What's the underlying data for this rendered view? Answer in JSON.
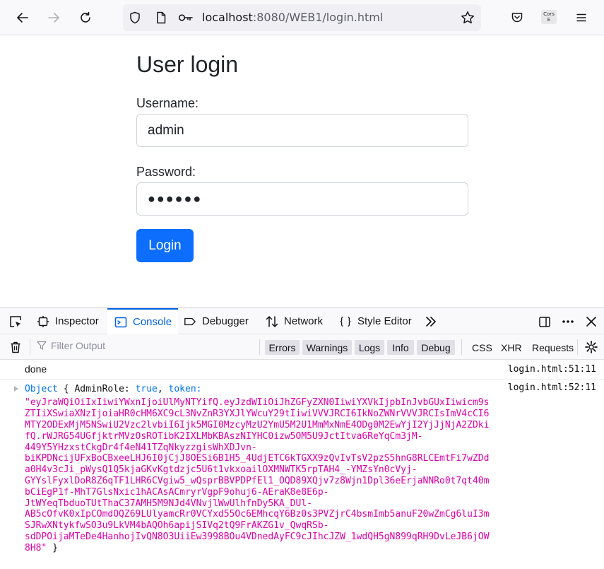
{
  "browser": {
    "url_host": "localhost",
    "url_rest": ":8080/WEB1/login.html",
    "extension_badge_line1": "Cors",
    "extension_badge_line2": "E"
  },
  "page": {
    "title": "User login",
    "username_label": "Username:",
    "username_value": "admin",
    "password_label": "Password:",
    "password_value": "●●●●●●",
    "login_button": "Login"
  },
  "devtools": {
    "tabs": [
      {
        "label": "Inspector",
        "active": false
      },
      {
        "label": "Console",
        "active": true
      },
      {
        "label": "Debugger",
        "active": false
      },
      {
        "label": "Network",
        "active": false
      },
      {
        "label": "Style Editor",
        "active": false
      }
    ],
    "filter_placeholder": "Filter Output",
    "levels": [
      "Errors",
      "Warnings",
      "Logs",
      "Info",
      "Debug"
    ],
    "request_filters": [
      "CSS",
      "XHR",
      "Requests"
    ]
  },
  "console": {
    "rows": [
      {
        "message": "done",
        "source": "login.html",
        "line": ":51:11"
      },
      {
        "source": "login.html",
        "line": ":52:11"
      }
    ],
    "object_label": "Object",
    "open_brace": "{",
    "key_adminrole": "AdminRole:",
    "value_adminrole": "true",
    "comma": ",",
    "key_token": "token:",
    "token_lines": [
      "\"eyJraWQiOiIxIiwiYWxnIjoiUlMyNTYifQ.eyJzdWIiOiJhZGFyZXN0IiwiYXVkIjpbInJvbGUxIiwicm9s",
      "ZTIiXSwiaXNzIjoiaHR0cHM6XC9cL3NvZnR3YXJlYWcuY29tIiwiVVVJRCI6IkNoZWNrVVVJRCIsImV4cCI6",
      "MTY2ODExMjM5NSwiU2Vzc2lvbiI6Ijk5MGI0MzcyMzU2YmU5M2U1MmMxNmE4ODg0M2EwYjI2YjJjNjA2ZDki",
      "fQ.rWJRG54UGfjktrMVzOsROTibK2IXLMbKBAszNIYHC0izw5OM5U9JctItva6ReYqCm3jM-",
      "449Y5YHzxstCkgDr4f4eN41TZqNkyzzgisWhXDJvn-",
      "biKPDNcijUFxBoCBxeeLHJ6I0jCjJ8OESi6B1H5_4UdjETC6kTGXX9zQvIvTsV2pzS5hnG8RLCEmtFi7wZDd",
      "a0H4v3cJi_pWysQ1Q5kjaGKvKgtdzjc5U6t1vkxoailOXMNWTK5rpTAH4_-YMZsYn0cVyj-",
      "GYYslFyxlDoR8Z6qTF1LHR6CVgiw5_wQsprBBVPDPfEl1_OQD89XQjv7z8Wjn1Dpl36eErjaNNRo0t7qt40m",
      "bCiEgP1f-MhT7GlsNxic1hACAsACmryrVgpF9ohuj6-AEraK8e8E6p-",
      "JtWYeqTbduoTUtThaC37AMH5M9NJd4VNvjlWwUlhfnDy5KA_DUl-",
      "AB5cOfvK0xIpCOmdOQZ69LUlyamcRr0VCYxd55Oc6EMhcqY6Bz0s3PVZjrC4bsmImb5anuF20wZmCg6luI3m",
      "SJRwXNtykfwSO3u9LkVM4bAQOh6apijSIVq2tQ9FrAKZG1v_QwqRSb-",
      "sdDPOijaMTeDe4HanhojIvQN8O3UiiEw3998BOu4VDnedAyFC9cJIhcJZW_1wdQH5gN899qRH9DvLeJB6jOW",
      "8H8\""
    ],
    "close_brace": "}"
  },
  "colors": {
    "primary_button": "#0d6efd",
    "devtools_active_tab": "#0061e0",
    "console_string": "#dd00a9",
    "console_keyword": "#0074e8"
  }
}
